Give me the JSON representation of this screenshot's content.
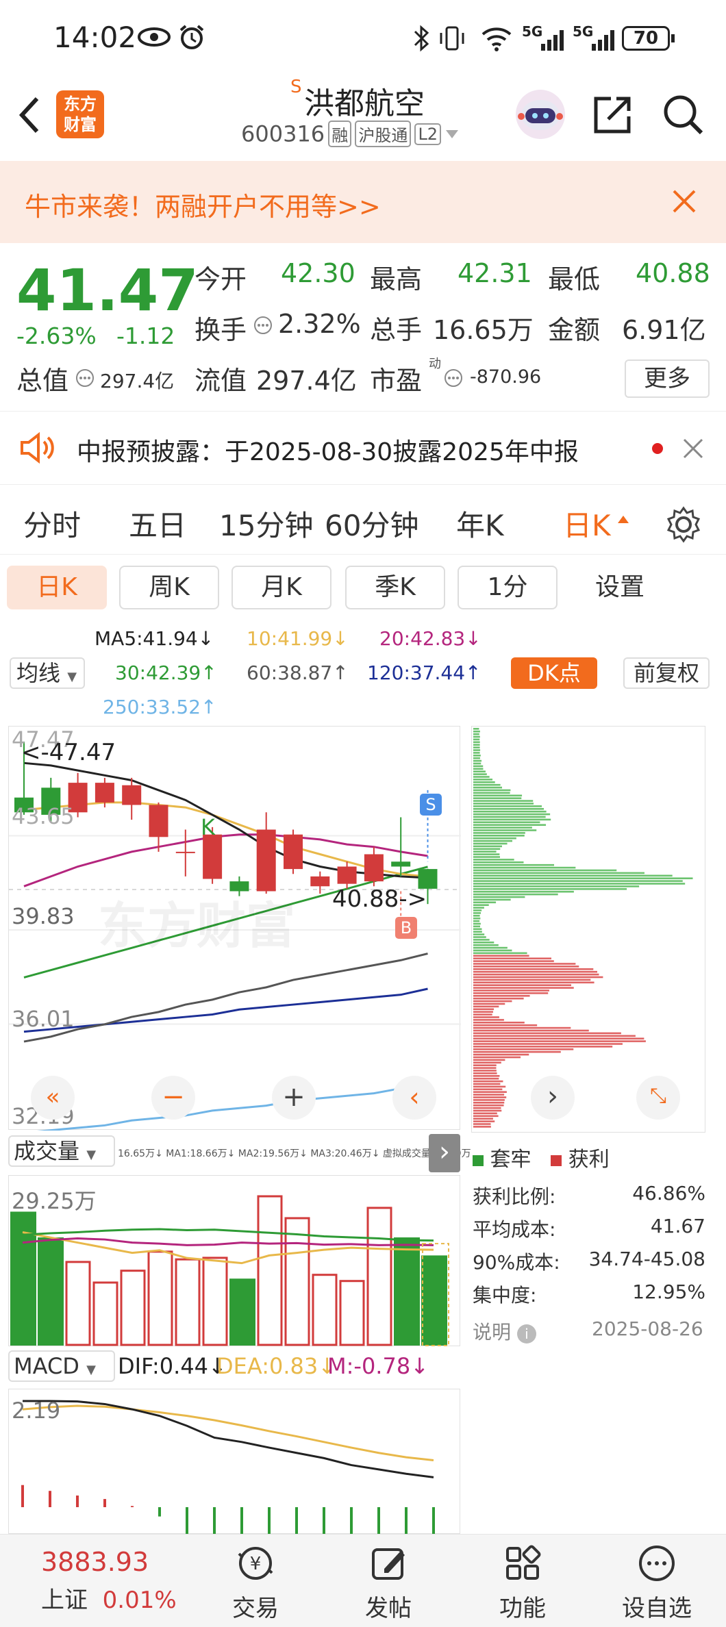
{
  "status": {
    "time": "14:02",
    "battery": "70",
    "net1": "5G",
    "net2": "5G"
  },
  "header": {
    "badge_line1": "东方",
    "badge_line2": "财富",
    "superscript": "S",
    "title": "洪都航空",
    "code": "600316",
    "tag_rong": "融",
    "tag_hgt": "沪股通",
    "tag_level": "L2"
  },
  "banner": {
    "text": "牛市来袭！两融开户不用等>>"
  },
  "quote": {
    "price": "41.47",
    "change_pct": "-2.63%",
    "change_amt": "-1.12",
    "open_label": "今开",
    "open": "42.30",
    "high_label": "最高",
    "high": "42.31",
    "low_label": "最低",
    "low": "40.88",
    "turnover_label": "换手",
    "turnover": "2.32%",
    "volume_label": "总手",
    "volume": "16.65万",
    "amount_label": "金额",
    "amount": "6.91亿",
    "mktcap_label": "总值",
    "mktcap": "297.4亿",
    "float_label": "流值",
    "float": "297.4亿",
    "pe_label": "市盈",
    "pe_sup": "动",
    "pe": "-870.96",
    "more": "更多"
  },
  "notice": {
    "text": "中报预披露：于2025-08-30披露2025年中报"
  },
  "tabs": [
    "分时",
    "五日",
    "15分钟",
    "60分钟",
    "年K",
    "日K"
  ],
  "subtabs": [
    "日K",
    "周K",
    "月K",
    "季K",
    "1分",
    "设置"
  ],
  "ma": {
    "ma5": "MA5:41.94",
    "ma10": "10:41.99",
    "ma20": "20:42.83",
    "ma30": "30:42.39",
    "ma60": "60:38.87",
    "ma120": "120:37.44",
    "ma250": "250:33.52",
    "selector": "均线",
    "dk": "DK点",
    "fq": "前复权"
  },
  "colors": {
    "up": "#d23b3b",
    "down": "#2e9b35",
    "orange": "#f26b1d",
    "ma5": "#222222",
    "ma10": "#e8b84a",
    "ma20": "#b4257d",
    "ma30": "#2e9b35",
    "ma60": "#555555",
    "ma120": "#1c2f96",
    "ma250": "#6fb4e6"
  },
  "kchart": {
    "y_labels": [
      "47.47",
      "43.65",
      "39.83",
      "36.01",
      "32.19"
    ],
    "max_marker": "<-47.47",
    "min_marker": "40.88->",
    "k_mark": "K",
    "s_mark": "S",
    "b_mark": "B",
    "watermark": "东方财富",
    "candles": [
      {
        "o": 45.2,
        "c": 44.6,
        "h": 47.47,
        "l": 44.5
      },
      {
        "o": 45.6,
        "c": 44.5,
        "h": 46.0,
        "l": 44.2
      },
      {
        "o": 44.6,
        "c": 45.8,
        "h": 46.2,
        "l": 44.4
      },
      {
        "o": 45.0,
        "c": 45.8,
        "h": 46.0,
        "l": 44.8
      },
      {
        "o": 44.9,
        "c": 45.7,
        "h": 46.0,
        "l": 44.3
      },
      {
        "o": 43.6,
        "c": 44.9,
        "h": 45.0,
        "l": 43.0
      },
      {
        "o": 43.0,
        "c": 43.0,
        "h": 43.9,
        "l": 42.0
      },
      {
        "o": 41.9,
        "c": 43.7,
        "h": 44.0,
        "l": 41.7
      },
      {
        "o": 41.8,
        "c": 41.4,
        "h": 42.0,
        "l": 41.2
      },
      {
        "o": 41.4,
        "c": 43.9,
        "h": 44.6,
        "l": 41.3
      },
      {
        "o": 42.3,
        "c": 43.7,
        "h": 43.9,
        "l": 42.1
      },
      {
        "o": 41.6,
        "c": 42.0,
        "h": 42.2,
        "l": 41.3
      },
      {
        "o": 41.7,
        "c": 42.4,
        "h": 42.6,
        "l": 41.5
      },
      {
        "o": 41.8,
        "c": 42.9,
        "h": 43.2,
        "l": 41.6
      },
      {
        "o": 42.6,
        "c": 42.4,
        "h": 44.4,
        "l": 42.0
      },
      {
        "o": 42.3,
        "c": 41.5,
        "h": 42.31,
        "l": 40.88
      }
    ],
    "ma5": [
      46.6,
      46.5,
      46.3,
      46.1,
      45.9,
      45.5,
      45.1,
      44.5,
      43.9,
      43.2,
      42.7,
      42.4,
      42.2,
      42.1,
      42.0,
      41.94
    ],
    "ma10": [
      44.7,
      44.8,
      44.9,
      45.0,
      45.0,
      44.9,
      44.8,
      44.5,
      44.1,
      43.7,
      43.2,
      42.9,
      42.6,
      42.3,
      42.1,
      41.99
    ],
    "ma20": [
      41.6,
      42.0,
      42.4,
      42.7,
      43.0,
      43.2,
      43.4,
      43.6,
      43.7,
      43.7,
      43.6,
      43.5,
      43.3,
      43.2,
      43.0,
      42.83
    ],
    "ma30": [
      37.9,
      38.2,
      38.5,
      38.8,
      39.1,
      39.4,
      39.7,
      40.0,
      40.3,
      40.6,
      40.9,
      41.2,
      41.5,
      41.8,
      42.1,
      42.39
    ],
    "ma60": [
      35.3,
      35.5,
      35.8,
      36.0,
      36.3,
      36.5,
      36.8,
      37.0,
      37.3,
      37.5,
      37.8,
      38.0,
      38.2,
      38.4,
      38.6,
      38.87
    ],
    "ma120": [
      35.7,
      35.8,
      35.9,
      36.0,
      36.1,
      36.2,
      36.3,
      36.4,
      36.6,
      36.7,
      36.8,
      36.9,
      37.0,
      37.1,
      37.2,
      37.44
    ],
    "ma250": [
      31.6,
      31.7,
      31.8,
      31.9,
      32.1,
      32.2,
      32.3,
      32.5,
      32.6,
      32.7,
      32.9,
      33.0,
      33.1,
      33.2,
      33.4,
      33.52
    ]
  },
  "chips": {
    "legend_trapped": "套牢",
    "legend_profit": "获利",
    "rows": [
      {
        "label": "获利比例:",
        "value": "46.86%"
      },
      {
        "label": "平均成本:",
        "value": "41.67"
      },
      {
        "label": "90%成本:",
        "value": "34.74-45.08"
      },
      {
        "label": "集中度:",
        "value": "12.95%"
      }
    ],
    "note_label": "说明",
    "date": "2025-08-26"
  },
  "volume": {
    "label": "成交量",
    "line": "16.65万↓ MA1:18.66万↓ MA2:19.56万↓ MA3:20.46万↓ 虚拟成交量:19.79万",
    "max_label": "29.25万",
    "bars": [
      26,
      21,
      16.5,
      12.5,
      14.8,
      18.5,
      17,
      17.3,
      13,
      29.25,
      25,
      14,
      12.8,
      27,
      21,
      17.5
    ]
  },
  "macd": {
    "label": "MACD",
    "dif": "DIF:0.44↓",
    "dea": "DEA:0.83↓",
    "m": "M:-0.78↓",
    "top_label": "2.19"
  },
  "bottom": {
    "index_value": "3883.93",
    "index_name": "上证",
    "index_change": "0.01%",
    "trade": "交易",
    "post": "发帖",
    "func": "功能",
    "watch": "设自选"
  }
}
